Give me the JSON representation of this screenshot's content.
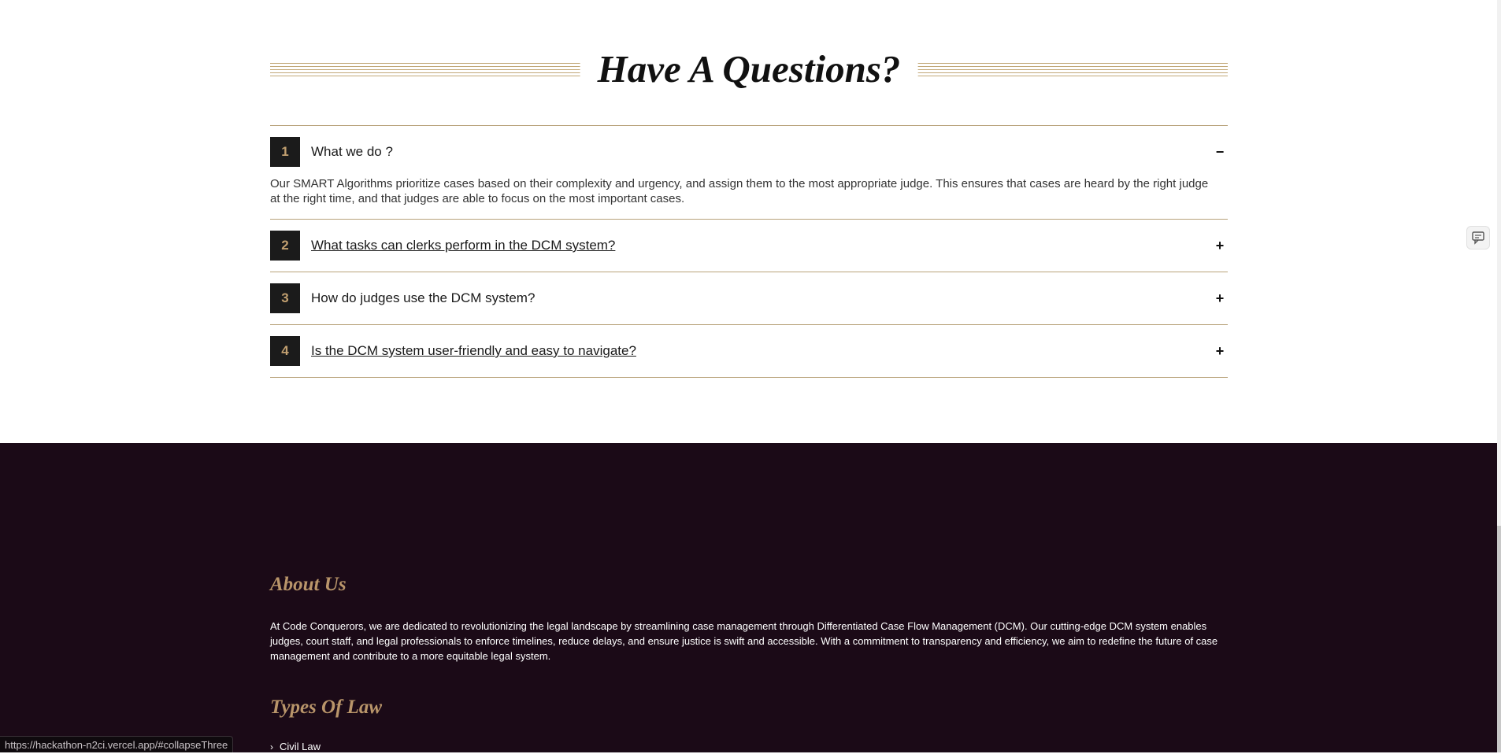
{
  "faq": {
    "title": "Have A Questions?",
    "items": [
      {
        "num": "1",
        "question": "What we do ?",
        "toggle": "−",
        "expanded": true,
        "answer": "Our SMART Algorithms prioritize cases based on their complexity and urgency, and assign them to the most appropriate judge. This ensures that cases are heard by the right judge at the right time, and that judges are able to focus on the most important cases."
      },
      {
        "num": "2",
        "question": " What tasks can clerks perform in the DCM system?",
        "toggle": "+",
        "expanded": false
      },
      {
        "num": "3",
        "question": "How do judges use the DCM system?",
        "toggle": "+",
        "expanded": false
      },
      {
        "num": "4",
        "question": " Is the DCM system user-friendly and easy to navigate?",
        "toggle": "+",
        "expanded": false
      }
    ]
  },
  "footer": {
    "about_title": "About Us",
    "about_text": "At Code Conquerors, we are dedicated to revolutionizing the legal landscape by streamlining case management through Differentiated Case Flow Management (DCM). Our cutting-edge DCM system enables judges, court staff, and legal professionals to enforce timelines, reduce delays, and ensure justice is swift and accessible. With a commitment to transparency and efficiency, we aim to redefine the future of case management and contribute to a more equitable legal system.",
    "types_title": "Types Of Law",
    "law_items": [
      {
        "label": "Civil Law",
        "icon": "chevron-right-icon"
      }
    ]
  },
  "status": {
    "url": "https://hackathon-n2ci.vercel.app/#collapseThree"
  },
  "colors": {
    "accent_gold": "#b9956a",
    "footer_bg": "#1b0a17",
    "number_bg": "#1b1b1b"
  },
  "icons": {
    "side": "chat-feedback-icon"
  }
}
